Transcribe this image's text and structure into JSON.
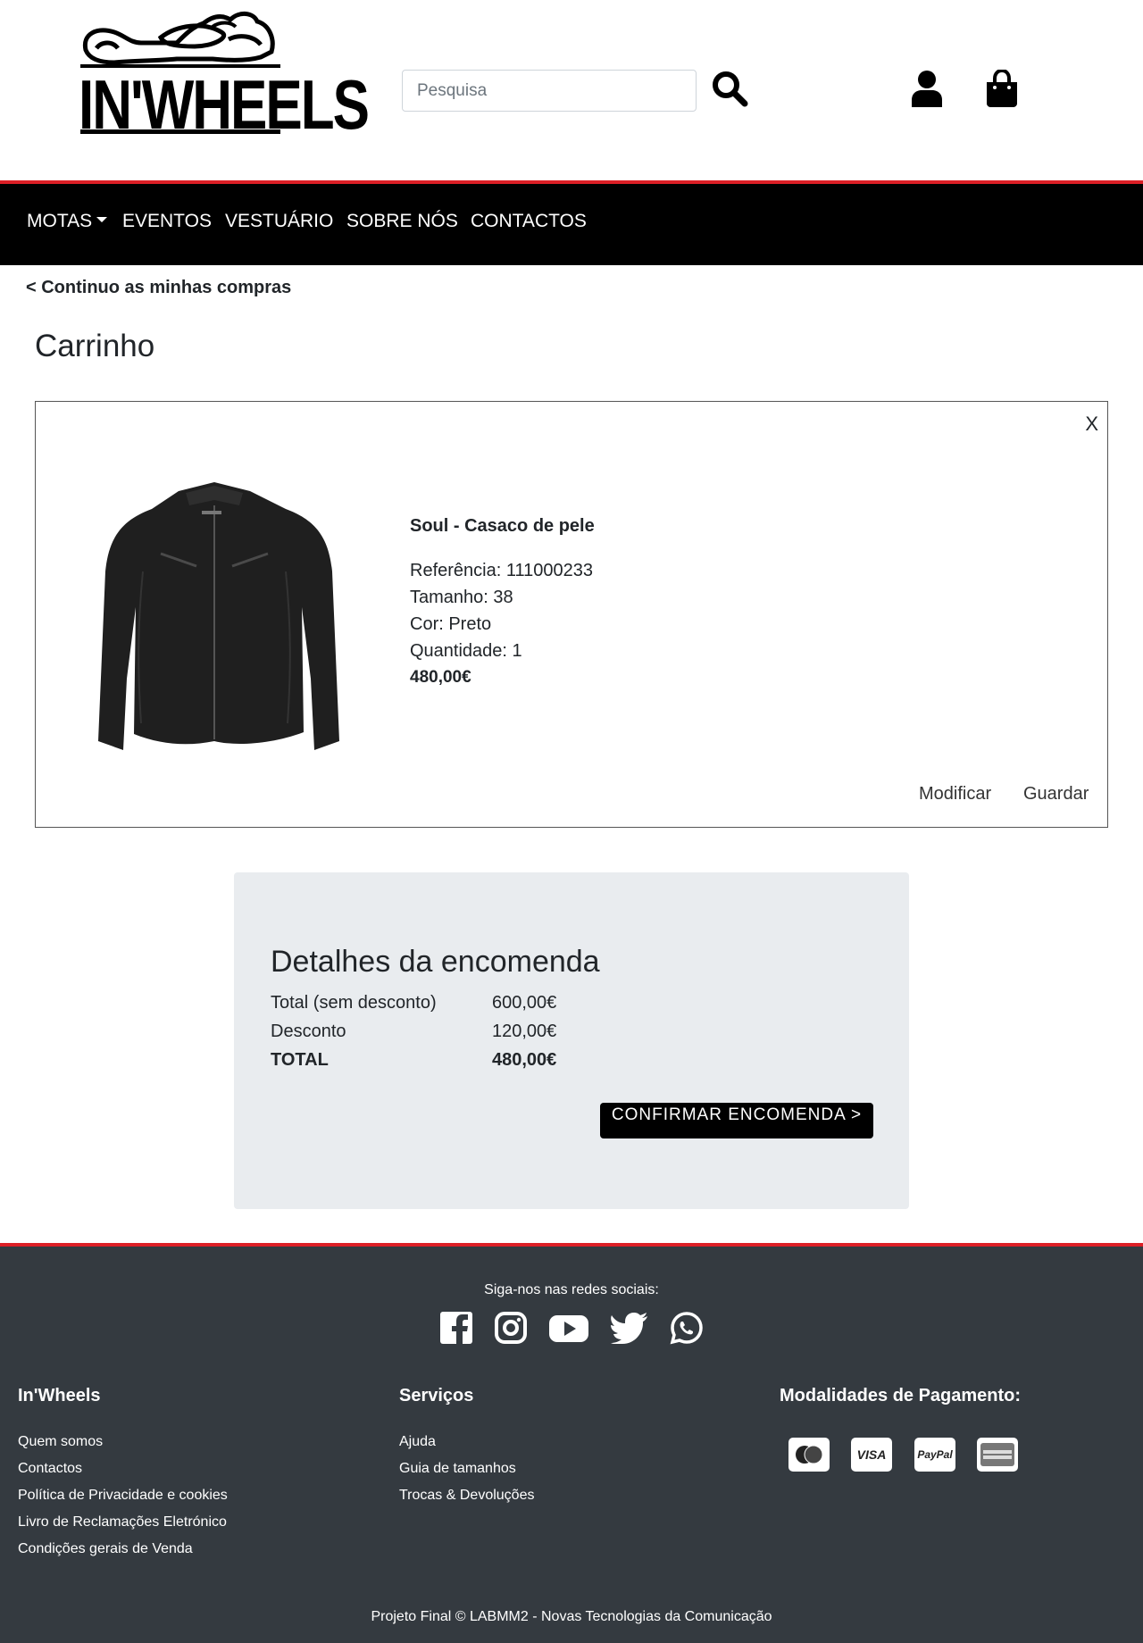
{
  "brand": {
    "logo_text": "IN'WHEELS"
  },
  "search": {
    "placeholder": "Pesquisa"
  },
  "nav": {
    "items": [
      {
        "label": "MOTAS"
      },
      {
        "label": "EVENTOS"
      },
      {
        "label": "VESTUÁRIO"
      },
      {
        "label": "SOBRE NÓS"
      },
      {
        "label": "CONTACTOS"
      }
    ]
  },
  "back_link": "< Continuo as minhas compras",
  "page_title": "Carrinho",
  "cart": {
    "remove_label": "X",
    "item": {
      "name": "Soul - Casaco de pele",
      "reference": "Referência: 111000233",
      "size": "Tamanho: 38",
      "color": "Cor: Preto",
      "quantity": "Quantidade: 1",
      "price": "480,00€"
    },
    "modify_label": "Modificar",
    "save_label": "Guardar"
  },
  "order": {
    "title": "Detalhes da encomenda",
    "rows": [
      {
        "label": "Total (sem desconto)",
        "value": "600,00€"
      },
      {
        "label": "Desconto",
        "value": "120,00€"
      },
      {
        "label": "TOTAL",
        "value": "480,00€"
      }
    ],
    "confirm_label": "CONFIRMAR ENCOMENDA >"
  },
  "footer": {
    "follow_text": "Siga-nos nas redes sociais:",
    "social": [
      "facebook-icon",
      "instagram-icon",
      "youtube-icon",
      "twitter-icon",
      "whatsapp-icon"
    ],
    "col1": {
      "title": "In'Wheels",
      "links": [
        "Quem somos",
        "Contactos",
        "Política de Privacidade e cookies",
        "Livro de Reclamações Eletrónico",
        "Condições gerais de Venda"
      ]
    },
    "col2": {
      "title": "Serviços",
      "links": [
        "Ajuda",
        "Guia de tamanhos",
        "Trocas & Devoluções"
      ]
    },
    "col3": {
      "title": "Modalidades de Pagamento:",
      "methods": [
        "mastercard-icon",
        "VISA",
        "PayPal",
        "american-express-icon"
      ]
    },
    "copyright": "Projeto Final © LABMM2 - Novas Tecnologias da Comunicação"
  },
  "colors": {
    "accent": "#dc1f26",
    "nav_bg": "#000000",
    "footer_bg": "#343a40",
    "summary_bg": "#e9ecef"
  }
}
